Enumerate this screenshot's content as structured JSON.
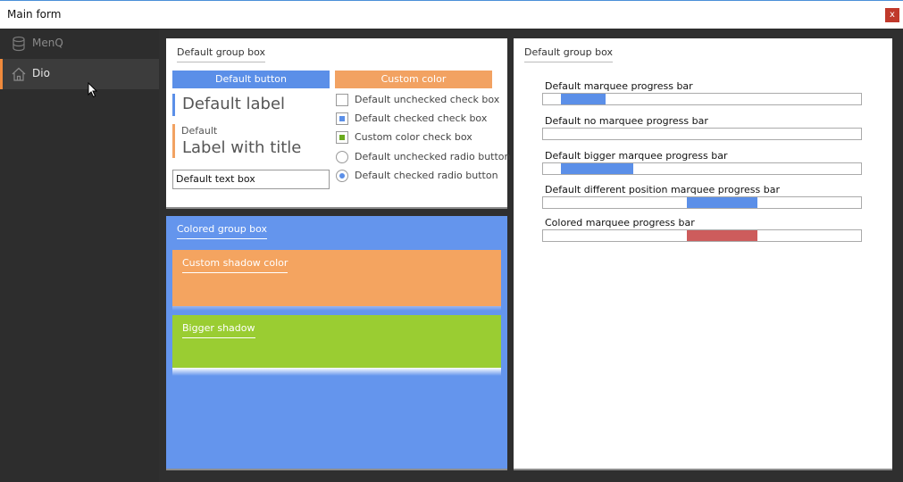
{
  "window": {
    "title": "Main form",
    "close_label": "x"
  },
  "sidebar": {
    "items": [
      {
        "label": "MenQ",
        "icon": "database-icon"
      },
      {
        "label": "Dio",
        "icon": "home-icon"
      }
    ]
  },
  "left_panel": {
    "title": "Default group box",
    "default_button": "Default button",
    "custom_color_button": "Custom color",
    "default_label": "Default label",
    "label_with_title": {
      "title": "Default",
      "text": "Label with title"
    },
    "text_box_value": "Default text box",
    "checkboxes": [
      {
        "label": "Default unchecked check box",
        "checked": false
      },
      {
        "label": "Default checked check box",
        "checked": true
      },
      {
        "label": "Custom color check box",
        "checked": true
      }
    ],
    "radios": [
      {
        "label": "Default unchecked radio button",
        "checked": false
      },
      {
        "label": "Default checked radio button",
        "checked": true
      }
    ]
  },
  "colored_panel": {
    "title": "Colored group box",
    "custom_shadow_title": "Custom shadow color",
    "bigger_shadow_title": "Bigger shadow"
  },
  "right_panel": {
    "title": "Default group box",
    "progress_bars": [
      {
        "label": "Default marquee progress bar",
        "start": 0.055,
        "end": 0.195
      },
      {
        "label": "Default no marquee progress bar",
        "start": 0,
        "end": 0
      },
      {
        "label": "Default bigger marquee progress bar",
        "start": 0.055,
        "end": 0.28
      },
      {
        "label": "Default different position marquee progress bar",
        "start": 0.45,
        "end": 0.67
      },
      {
        "label": "Colored marquee progress bar",
        "start": 0.45,
        "end": 0.67
      }
    ]
  },
  "colors": {
    "accent_blue": "#5b8fe8",
    "accent_orange": "#f2a262",
    "custom_green": "#6aaa1e",
    "bigger_shadow_green": "#9acd32",
    "colored_bar_red": "#cd5c5c",
    "close_red": "#c0392b",
    "sidebar_accent": "#f08a3c"
  }
}
